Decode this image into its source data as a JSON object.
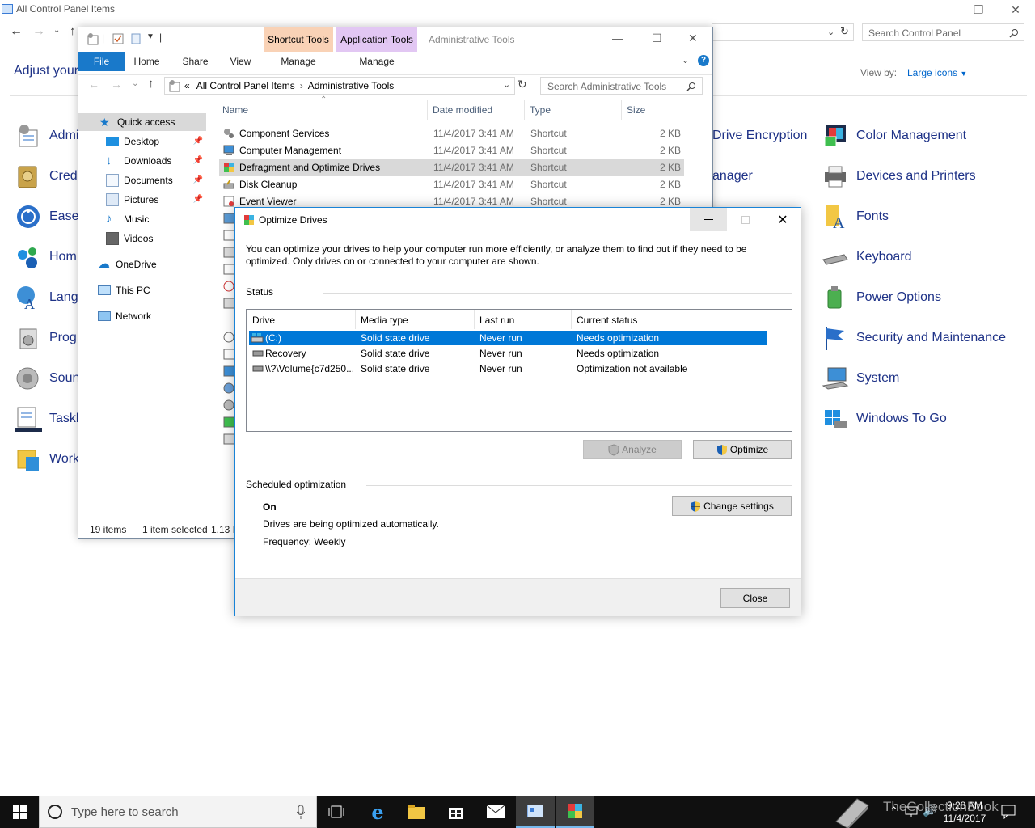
{
  "control_panel": {
    "title": "All Control Panel Items",
    "search_placeholder": "Search Control Panel",
    "heading": "Adjust your",
    "view_by_label": "View by:",
    "view_by_value": "Large icons",
    "left_items": [
      "Admi",
      "Crede",
      "Ease",
      "Hom",
      "Lang",
      "Prog",
      "Soun",
      "Taskb",
      "Work"
    ],
    "mid_items": [
      "Drive Encryption",
      "anager"
    ],
    "right_items": [
      "Color Management",
      "Devices and Printers",
      "Fonts",
      "Keyboard",
      "Power Options",
      "Security and Maintenance",
      "System",
      "Windows To Go"
    ]
  },
  "explorer": {
    "title": "Administrative Tools",
    "ribbon": {
      "file": "File",
      "home": "Home",
      "share": "Share",
      "view": "View",
      "shortcut_tools": "Shortcut Tools",
      "application_tools": "Application Tools",
      "manage_1": "Manage",
      "manage_2": "Manage"
    },
    "address": {
      "prefix": "«",
      "crumb1": "All Control Panel Items",
      "sep": "›",
      "crumb2": "Administrative Tools"
    },
    "search_placeholder": "Search Administrative Tools",
    "nav": {
      "quick_access": "Quick access",
      "desktop": "Desktop",
      "downloads": "Downloads",
      "documents": "Documents",
      "pictures": "Pictures",
      "music": "Music",
      "videos": "Videos",
      "onedrive": "OneDrive",
      "this_pc": "This PC",
      "network": "Network"
    },
    "columns": {
      "name": "Name",
      "date": "Date modified",
      "type": "Type",
      "size": "Size"
    },
    "files": [
      {
        "name": "Component Services",
        "date": "11/4/2017 3:41 AM",
        "type": "Shortcut",
        "size": "2 KB"
      },
      {
        "name": "Computer Management",
        "date": "11/4/2017 3:41 AM",
        "type": "Shortcut",
        "size": "2 KB"
      },
      {
        "name": "Defragment and Optimize Drives",
        "date": "11/4/2017 3:41 AM",
        "type": "Shortcut",
        "size": "2 KB"
      },
      {
        "name": "Disk Cleanup",
        "date": "11/4/2017 3:41 AM",
        "type": "Shortcut",
        "size": "2 KB"
      },
      {
        "name": "Event Viewer",
        "date": "11/4/2017 3:41 AM",
        "type": "Shortcut",
        "size": "2 KB"
      }
    ],
    "status": {
      "count": "19 items",
      "selected": "1 item selected",
      "size": "1.13 K"
    }
  },
  "dialog": {
    "title": "Optimize Drives",
    "intro_line1": "You can optimize your drives to help your computer run more efficiently, or analyze them to find out if they need to be",
    "intro_line2": "optimized. Only drives on or connected to your computer are shown.",
    "status_label": "Status",
    "columns": {
      "drive": "Drive",
      "media": "Media type",
      "last_run": "Last run",
      "status": "Current status"
    },
    "drives": [
      {
        "drive": "(C:)",
        "media": "Solid state drive",
        "last_run": "Never run",
        "status": "Needs optimization"
      },
      {
        "drive": "Recovery",
        "media": "Solid state drive",
        "last_run": "Never run",
        "status": "Needs optimization"
      },
      {
        "drive": "\\\\?\\Volume{c7d250...",
        "media": "Solid state drive",
        "last_run": "Never run",
        "status": "Optimization not available"
      }
    ],
    "analyze": "Analyze",
    "optimize": "Optimize",
    "scheduled_label": "Scheduled optimization",
    "sched_state": "On",
    "sched_desc": "Drives are being optimized automatically.",
    "sched_freq": "Frequency: Weekly",
    "change_settings": "Change settings",
    "close": "Close"
  },
  "taskbar": {
    "search_placeholder": "Type here to search",
    "time": "9:28 AM",
    "date": "11/4/2017"
  },
  "watermark": "TheCollectionBook",
  "colors": {
    "accent": "#0078d7",
    "link": "#1e3287",
    "selection": "#d9d9d9"
  }
}
